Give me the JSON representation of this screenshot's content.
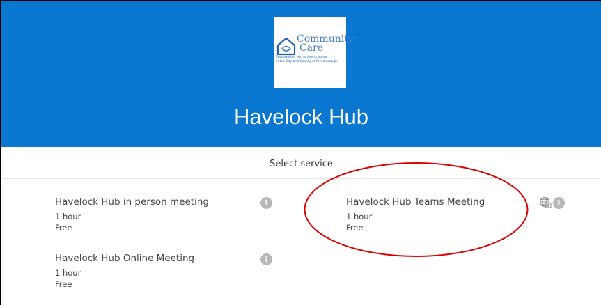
{
  "header": {
    "logo": {
      "name_line1": "Community",
      "name_line2": "Care",
      "tagline_line1": "Empowering you to live at home",
      "tagline_line2": "in the City and County of Peterborough"
    },
    "title": "Havelock Hub",
    "background_color": "#0a78d0"
  },
  "section": {
    "label": "Select service"
  },
  "services": [
    {
      "name": "Havelock Hub in person meeting",
      "duration": "1 hour",
      "price": "Free",
      "icons": [
        "info-icon"
      ]
    },
    {
      "name": "Havelock Hub Teams Meeting",
      "duration": "1 hour",
      "price": "Free",
      "icons": [
        "globe-icon",
        "info-icon"
      ]
    },
    {
      "name": "Havelock Hub Online Meeting",
      "duration": "1 hour",
      "price": "Free",
      "icons": [
        "info-icon"
      ]
    }
  ],
  "annotation": {
    "highlight_color": "#dd0000",
    "highlighted_service": "Havelock Hub Teams Meeting"
  },
  "icons": {
    "info_glyph": "i"
  }
}
